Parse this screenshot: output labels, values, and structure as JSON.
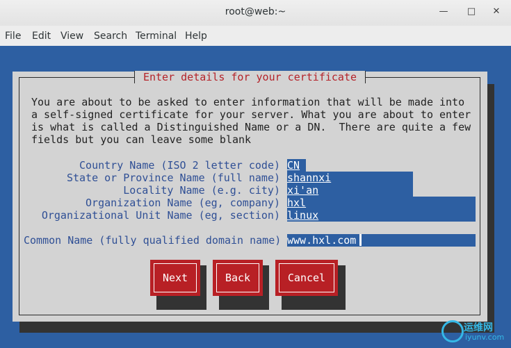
{
  "window": {
    "title": "root@web:~"
  },
  "menu": [
    "File",
    "Edit",
    "View",
    "Search",
    "Terminal",
    "Help"
  ],
  "dialog": {
    "title": "Enter details for your certificate",
    "paragraph": [
      "You are about to be asked to enter information that will be made into",
      "a self-signed certificate for your server. What you are about to enter",
      "is what is called a Distinguished Name or a DN.  There are quite a few",
      "fields but you can leave some blank"
    ],
    "fields": [
      {
        "label": "Country Name (ISO 2 letter code)",
        "value": "CN"
      },
      {
        "label": "State or Province Name (full name)",
        "value": "shannxi"
      },
      {
        "label": "Locality Name (e.g. city)",
        "value": "xi'an"
      },
      {
        "label": "Organization Name (eg, company)",
        "value": "hxl"
      },
      {
        "label": "Organizational Unit Name (eg, section)",
        "value": "linux"
      }
    ],
    "common_name": {
      "label": "Common Name (fully qualified domain name)",
      "value": "www.hxl.com"
    },
    "buttons": {
      "next": "Next",
      "back": "Back",
      "cancel": "Cancel"
    }
  },
  "watermark": {
    "title": "运维网",
    "subtitle": "iyunv.com"
  },
  "colors": {
    "terminal_bg": "#2d5fa2",
    "dialog_bg": "#d3d3d3",
    "button": "#b82025",
    "title_text": "#b4232a"
  }
}
